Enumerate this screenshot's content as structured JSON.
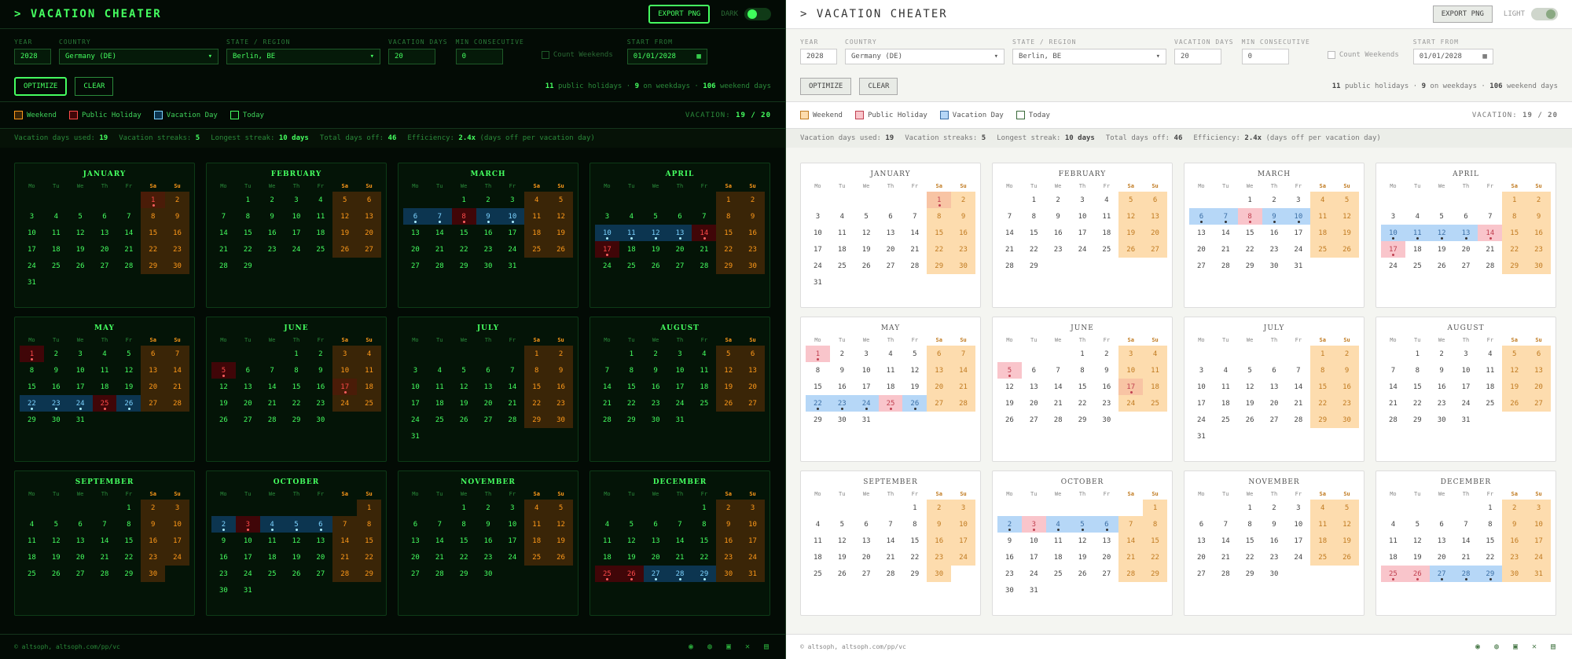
{
  "app": {
    "title": "> VACATION CHEATER",
    "export_label": "EXPORT PNG",
    "mode_dark": "DARK",
    "mode_light": "LIGHT"
  },
  "controls": {
    "year_label": "YEAR",
    "year": "2028",
    "country_label": "COUNTRY",
    "country": "Germany (DE)",
    "state_label": "STATE / REGION",
    "state": "Berlin, BE",
    "vacation_label": "VACATION DAYS",
    "vacation": "20",
    "consec_label": "MIN CONSECUTIVE",
    "consec": "0",
    "weekends_label": "Count Weekends",
    "start_label": "START FROM",
    "start": "01/01/2028",
    "optimize_label": "OPTIMIZE",
    "clear_label": "CLEAR"
  },
  "stats": {
    "holidays": "11",
    "holidays_text": "public holidays",
    "weekdays": "9",
    "weekdays_text": "on weekdays",
    "weekend": "106",
    "weekend_text": "weekend days"
  },
  "legend": {
    "weekend": "Weekend",
    "holiday": "Public Holiday",
    "vacation": "Vacation Day",
    "today": "Today",
    "vac_label": "VACATION:",
    "vac_value": "19 / 20"
  },
  "summary": {
    "used_label": "Vacation days used:",
    "used": "19",
    "streaks_label": "Vacation streaks:",
    "streaks": "5",
    "longest_label": "Longest streak:",
    "longest": "10 days",
    "total_label": "Total days off:",
    "total": "46",
    "eff_label": "Efficiency:",
    "eff": "2.4x",
    "eff_note": "(days off per vacation day)"
  },
  "weekdays": [
    "Mo",
    "Tu",
    "We",
    "Th",
    "Fr",
    "Sa",
    "Su"
  ],
  "months": [
    {
      "name": "JANUARY",
      "offset": 5,
      "days": 31,
      "hol": [
        1
      ],
      "vac": []
    },
    {
      "name": "FEBRUARY",
      "offset": 1,
      "days": 29,
      "hol": [],
      "vac": []
    },
    {
      "name": "MARCH",
      "offset": 2,
      "days": 31,
      "hol": [
        8
      ],
      "vac": [
        6,
        7,
        9,
        10
      ]
    },
    {
      "name": "APRIL",
      "offset": 5,
      "days": 30,
      "hol": [
        14,
        17
      ],
      "vac": [
        10,
        11,
        12,
        13
      ]
    },
    {
      "name": "MAY",
      "offset": 0,
      "days": 31,
      "hol": [
        1,
        25
      ],
      "vac": [
        22,
        23,
        24,
        26
      ]
    },
    {
      "name": "JUNE",
      "offset": 3,
      "days": 30,
      "hol": [
        5
      ],
      "vac": [],
      "special": [
        17
      ]
    },
    {
      "name": "JULY",
      "offset": 5,
      "days": 31,
      "hol": [],
      "vac": []
    },
    {
      "name": "AUGUST",
      "offset": 1,
      "days": 31,
      "hol": [],
      "vac": []
    },
    {
      "name": "SEPTEMBER",
      "offset": 4,
      "days": 30,
      "hol": [],
      "vac": []
    },
    {
      "name": "OCTOBER",
      "offset": 6,
      "days": 31,
      "hol": [
        3
      ],
      "vac": [
        2,
        4,
        5,
        6
      ]
    },
    {
      "name": "NOVEMBER",
      "offset": 2,
      "days": 30,
      "hol": [],
      "vac": []
    },
    {
      "name": "DECEMBER",
      "offset": 4,
      "days": 31,
      "hol": [
        25,
        26
      ],
      "vac": [
        27,
        28,
        29
      ]
    }
  ],
  "footer": {
    "credit": "© altsoph, altsoph.com/pp/vc"
  },
  "colors": {
    "dark_accent": "#45ff60",
    "weekend": "#ff9a1a",
    "holiday": "#ff4a4a",
    "vacation": "#7cd3ff"
  }
}
